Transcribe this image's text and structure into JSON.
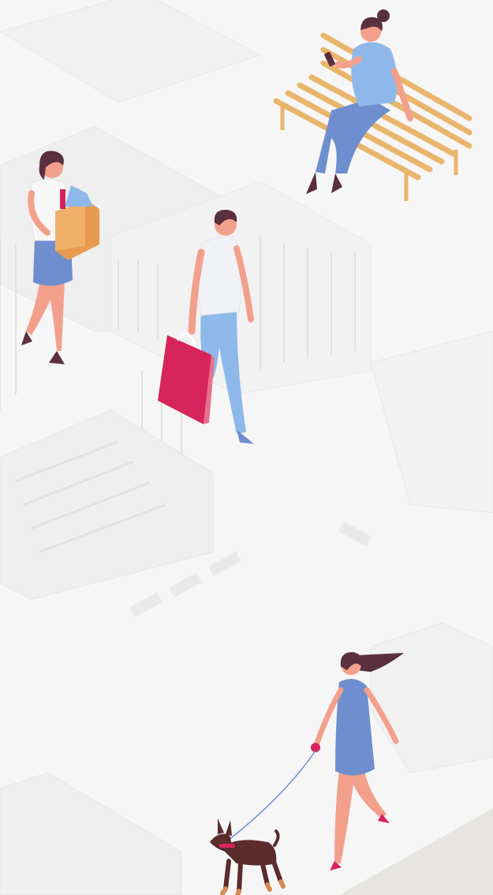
{
  "scene": {
    "description_free": true,
    "colors": {
      "background": "#f6f6f6",
      "building_light": "#efefef",
      "building_line": "#d9d9d9",
      "ground_corner": "#e7e5e1",
      "bench": "#e9b56c",
      "skin": "#f2a08c",
      "hair": "#5a2f3e",
      "blue_light": "#8fb8ea",
      "blue_mid": "#6f8ed0",
      "bag_pink": "#d8245c",
      "box_orange": "#e89a4e",
      "dog_brown": "#5a2c2c"
    },
    "figures": [
      {
        "name": "woman-on-bench",
        "item": "phone"
      },
      {
        "name": "woman-with-groceries",
        "item": "paper-bag"
      },
      {
        "name": "man-with-shopping-bag",
        "item": "shopping-bag"
      },
      {
        "name": "woman-walking-dog",
        "item": "dog-leash"
      }
    ]
  }
}
